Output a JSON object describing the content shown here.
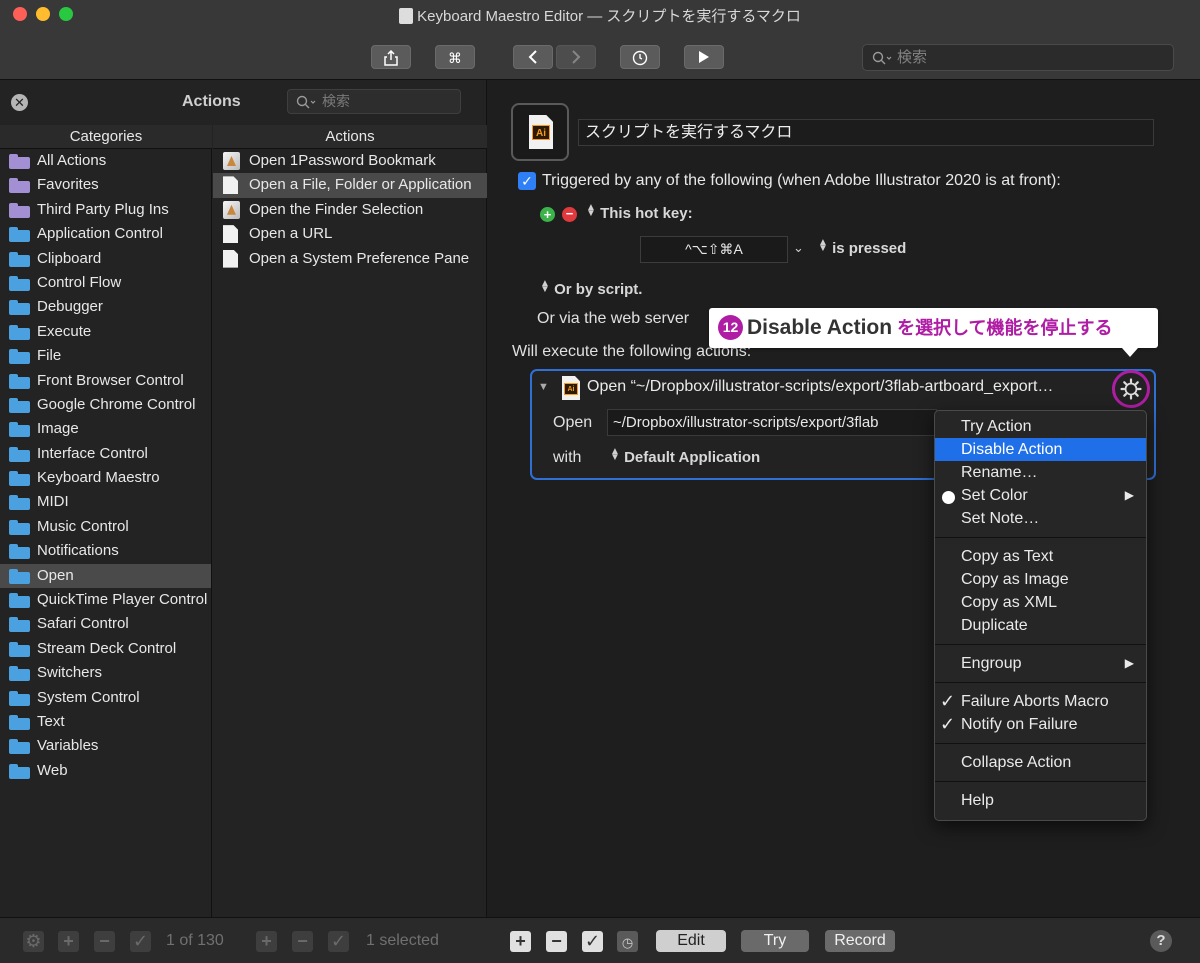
{
  "window": {
    "title": "Keyboard Maestro Editor — スクリプトを実行するマクロ",
    "search_placeholder": "検索"
  },
  "left_pane": {
    "title": "Actions",
    "search_placeholder": "検索",
    "categories_header": "Categories",
    "actions_header": "Actions",
    "categories": [
      {
        "label": "All Actions",
        "icon": "purple-folder-icon"
      },
      {
        "label": "Favorites",
        "icon": "purple-folder-icon"
      },
      {
        "label": "Third Party Plug Ins",
        "icon": "purple-folder-icon"
      },
      {
        "label": "Application Control",
        "icon": "folder-icon"
      },
      {
        "label": "Clipboard",
        "icon": "folder-icon"
      },
      {
        "label": "Control Flow",
        "icon": "folder-icon"
      },
      {
        "label": "Debugger",
        "icon": "folder-icon"
      },
      {
        "label": "Execute",
        "icon": "folder-icon"
      },
      {
        "label": "File",
        "icon": "folder-icon"
      },
      {
        "label": "Front Browser Control",
        "icon": "folder-icon"
      },
      {
        "label": "Google Chrome Control",
        "icon": "folder-icon"
      },
      {
        "label": "Image",
        "icon": "folder-icon"
      },
      {
        "label": "Interface Control",
        "icon": "folder-icon"
      },
      {
        "label": "Keyboard Maestro",
        "icon": "folder-icon"
      },
      {
        "label": "MIDI",
        "icon": "folder-icon"
      },
      {
        "label": "Music Control",
        "icon": "folder-icon"
      },
      {
        "label": "Notifications",
        "icon": "folder-icon"
      },
      {
        "label": "Open",
        "icon": "folder-icon",
        "selected": true
      },
      {
        "label": "QuickTime Player Control",
        "icon": "folder-icon"
      },
      {
        "label": "Safari Control",
        "icon": "folder-icon"
      },
      {
        "label": "Stream Deck Control",
        "icon": "folder-icon"
      },
      {
        "label": "Switchers",
        "icon": "folder-icon"
      },
      {
        "label": "System Control",
        "icon": "folder-icon"
      },
      {
        "label": "Text",
        "icon": "folder-icon"
      },
      {
        "label": "Variables",
        "icon": "folder-icon"
      },
      {
        "label": "Web",
        "icon": "folder-icon"
      }
    ],
    "actions": [
      {
        "label": "Open 1Password Bookmark",
        "icon": "app-icon"
      },
      {
        "label": "Open a File, Folder or Application",
        "icon": "document-icon",
        "selected": true
      },
      {
        "label": "Open the Finder Selection",
        "icon": "app-icon"
      },
      {
        "label": "Open a URL",
        "icon": "document-icon"
      },
      {
        "label": "Open a System Preference Pane",
        "icon": "document-icon"
      }
    ]
  },
  "macro": {
    "name": "スクリプトを実行するマクロ",
    "trigger_text": "Triggered by any of the following (when Adobe Illustrator 2020 is at front):",
    "hotkey_label": "This hot key:",
    "hotkey_value": "^⌥⇧⌘A",
    "pressed_label": "is pressed",
    "or_script": "Or by script.",
    "via_web": "Or via the web server",
    "will_execute": "Will execute the following actions:"
  },
  "callout": {
    "number": "12",
    "text_en": "Disable Action",
    "text_jp": " を選択して機能を停止する"
  },
  "action": {
    "title": "Open “~/Dropbox/illustrator-scripts/export/3flab-artboard_export…",
    "open_label": "Open",
    "path": "~/Dropbox/illustrator-scripts/export/3flab",
    "with_label": "with",
    "app_value": "Default Application"
  },
  "context_menu": {
    "group1": [
      {
        "label": "Try Action"
      },
      {
        "label": "Disable Action",
        "highlighted": true
      },
      {
        "label": "Rename…"
      },
      {
        "label": "Set Color",
        "submenu": true
      },
      {
        "label": "Set Note…"
      }
    ],
    "group2": [
      {
        "label": "Copy as Text"
      },
      {
        "label": "Copy as Image"
      },
      {
        "label": "Copy as XML"
      },
      {
        "label": "Duplicate"
      }
    ],
    "group3": [
      {
        "label": "Engroup",
        "submenu": true
      }
    ],
    "group4": [
      {
        "label": "Failure Aborts Macro",
        "checked": true
      },
      {
        "label": "Notify on Failure",
        "checked": true
      }
    ],
    "group5": [
      {
        "label": "Collapse Action"
      }
    ],
    "group6": [
      {
        "label": "Help"
      }
    ]
  },
  "bottom_bar": {
    "count_text": "1 of 130",
    "selected_text": "1 selected",
    "edit_label": "Edit",
    "try_label": "Try",
    "record_label": "Record",
    "help_label": "?"
  },
  "colors": {
    "accent_blue": "#2f7ff6",
    "highlight_blue": "#1f6fe8",
    "callout_magenta": "#b01da5",
    "folder_blue": "#4ba1e0",
    "folder_purple": "#a38fd3"
  }
}
